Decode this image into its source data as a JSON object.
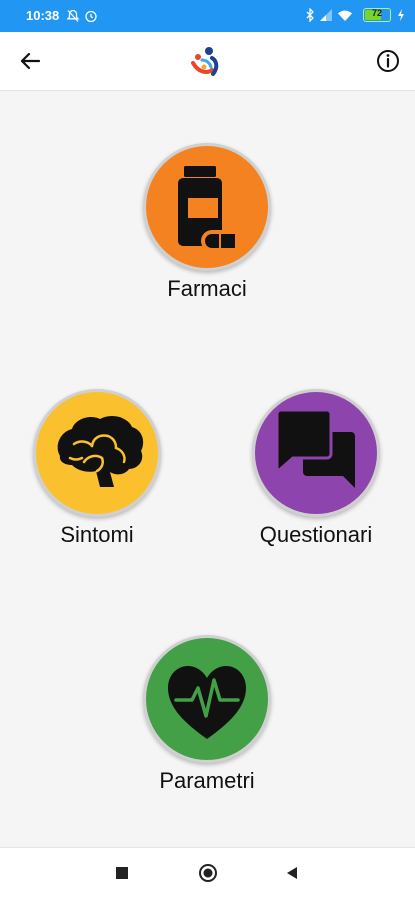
{
  "status_bar": {
    "time": "10:38",
    "battery": "72",
    "background": "#2196f3",
    "icons": [
      "notification-icon",
      "alarm-icon",
      "bluetooth-icon",
      "signal-icon",
      "wifi-icon",
      "battery-icon",
      "charging-icon"
    ]
  },
  "header": {
    "back_icon": "arrow-back",
    "logo": "app-logo",
    "info_icon": "info-outline"
  },
  "menu": {
    "farmaci": {
      "label": "Farmaci",
      "color": "#f58220",
      "icon": "medicine-bottle-pill"
    },
    "sintomi": {
      "label": "Sintomi",
      "color": "#fbc02d",
      "icon": "brain"
    },
    "questionari": {
      "label": "Questionari",
      "color": "#8e44ad",
      "icon": "chat-bubbles"
    },
    "parametri": {
      "label": "Parametri",
      "color": "#43a047",
      "icon": "heart-pulse"
    }
  },
  "nav_bar": {
    "icons": [
      "recent-apps",
      "home",
      "back"
    ]
  }
}
